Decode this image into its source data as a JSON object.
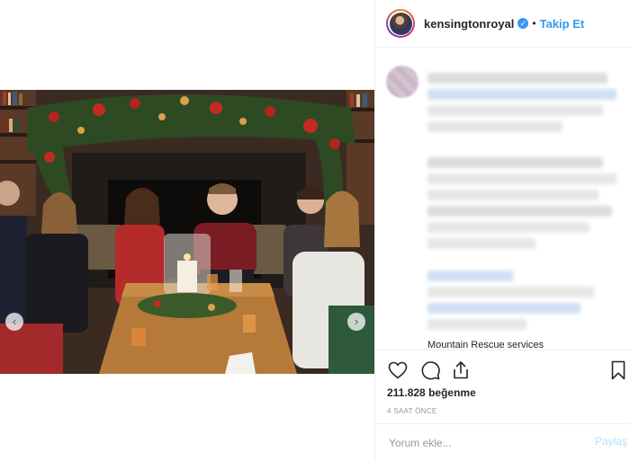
{
  "header": {
    "username": "kensingtonroyal",
    "separator": "•",
    "follow_label": "Takip Et",
    "verified_icon": "✓"
  },
  "photo": {
    "prev_icon": "‹",
    "next_icon": "›"
  },
  "comments": {
    "visible_text": "Mountain Rescue services"
  },
  "engagement": {
    "likes_count": "211.828",
    "likes_label": "beğenme",
    "time": "4 SAAT ÖNCE"
  },
  "comment_box": {
    "placeholder": "Yorum ekle...",
    "post_label": "Paylaş"
  },
  "colors": {
    "accent": "#3897f0",
    "post_disabled": "#b2dffc"
  }
}
